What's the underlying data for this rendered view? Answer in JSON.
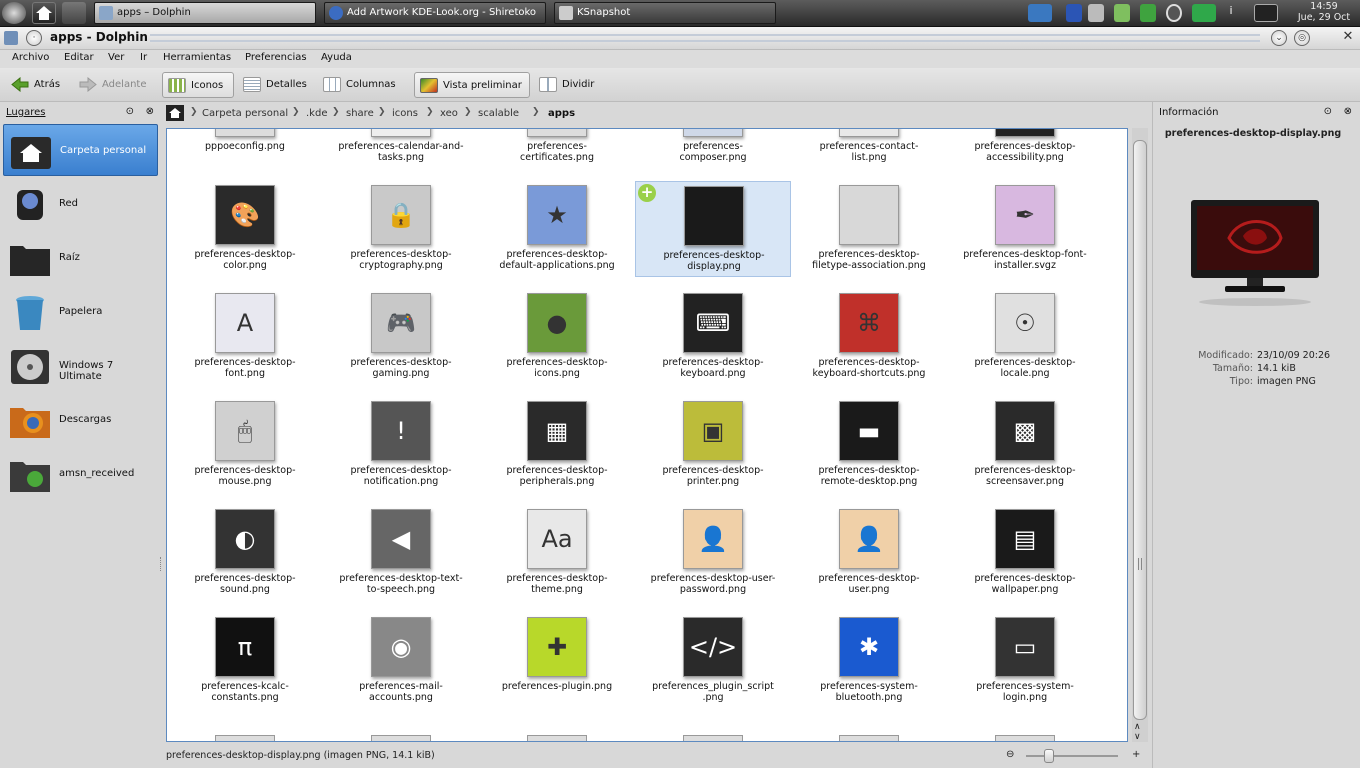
{
  "panel": {
    "tasks": [
      {
        "label": "apps – Dolphin",
        "active": true
      },
      {
        "label": "Add Artwork KDE-Look.org - Shiretoko",
        "active": false
      },
      {
        "label": "KSnapshot",
        "active": false
      }
    ],
    "clock_time": "14:59",
    "clock_date": "Jue, 29 Oct",
    "tray_icons": [
      "monitor-icon",
      "bluetooth-icon",
      "volume-icon",
      "battery-icon",
      "wifi-icon",
      "network-icon",
      "user-icon",
      "info-icon",
      "dvd-icon"
    ]
  },
  "window": {
    "title": "apps - Dolphin"
  },
  "menu": [
    "Archivo",
    "Editar",
    "Ver",
    "Ir",
    "Herramientas",
    "Preferencias",
    "Ayuda"
  ],
  "toolbar": {
    "back": "Atrás",
    "forward": "Adelante",
    "icons": "Iconos",
    "details": "Detalles",
    "columns": "Columnas",
    "preview": "Vista preliminar",
    "split": "Dividir"
  },
  "places": {
    "title": "Lugares",
    "items": [
      {
        "label": "Carpeta personal",
        "icon": "home-folder-icon",
        "selected": true
      },
      {
        "label": "Red",
        "icon": "network-drive-icon"
      },
      {
        "label": "Raíz",
        "icon": "folder-icon"
      },
      {
        "label": "Papelera",
        "icon": "trash-icon"
      },
      {
        "label": "Windows 7 Ultimate",
        "icon": "hard-disk-icon"
      },
      {
        "label": "Descargas",
        "icon": "firefox-folder-icon"
      },
      {
        "label": "amsn_received",
        "icon": "amsn-folder-icon"
      }
    ]
  },
  "breadcrumb": [
    "Carpeta personal",
    ".kde",
    "share",
    "icons",
    "xeo",
    "scalable",
    "apps"
  ],
  "files": [
    [
      "pppoeconfig.png",
      "preferences-calendar-and-\ntasks.png",
      "preferences-\ncertificates.png",
      "preferences-\ncomposer.png",
      "preferences-contact-\nlist.png",
      "preferences-desktop-\naccessibility.png"
    ],
    [
      "preferences-desktop-\ncolor.png",
      "preferences-desktop-\ncryptography.png",
      "preferences-desktop-\ndefault-applications.png",
      "preferences-desktop-\ndisplay.png",
      "preferences-desktop-\nfiletype-association.png",
      "preferences-desktop-font-\ninstaller.svgz"
    ],
    [
      "preferences-desktop-\nfont.png",
      "preferences-desktop-\ngaming.png",
      "preferences-desktop-\nicons.png",
      "preferences-desktop-\nkeyboard.png",
      "preferences-desktop-\nkeyboard-shortcuts.png",
      "preferences-desktop-\nlocale.png"
    ],
    [
      "preferences-desktop-\nmouse.png",
      "preferences-desktop-\nnotification.png",
      "preferences-desktop-\nperipherals.png",
      "preferences-desktop-\nprinter.png",
      "preferences-desktop-\nremote-desktop.png",
      "preferences-desktop-\nscreensaver.png"
    ],
    [
      "preferences-desktop-\nsound.png",
      "preferences-desktop-text-\nto-speech.png",
      "preferences-desktop-\ntheme.png",
      "preferences-desktop-user-\npassword.png",
      "preferences-desktop-\nuser.png",
      "preferences-desktop-\nwallpaper.png"
    ],
    [
      "preferences-kcalc-\nconstants.png",
      "preferences-mail-\naccounts.png",
      "preferences-plugin.png",
      "preferences_plugin_script\n.png",
      "preferences-system-\nbluetooth.png",
      "preferences-system-\nlogin.png"
    ]
  ],
  "selected_file": "preferences-desktop-display.png",
  "status": "preferences-desktop-display.png (imagen PNG, 14.1 kiB)",
  "info": {
    "title": "Información",
    "filename": "preferences-desktop-display.png",
    "rows": [
      {
        "key": "Modificado:",
        "value": "23/10/09 20:26"
      },
      {
        "key": "Tamaño:",
        "value": "14.1 kiB"
      },
      {
        "key": "Tipo:",
        "value": "imagen PNG"
      }
    ]
  },
  "zoom": {
    "level": 0.25
  }
}
